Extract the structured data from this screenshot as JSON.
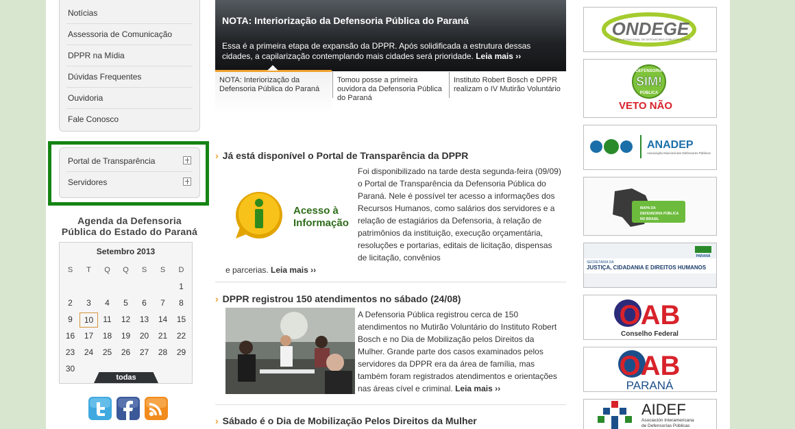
{
  "left_menu": {
    "items": [
      {
        "label": "Notícias"
      },
      {
        "label": "Assessoria de Comunicação"
      },
      {
        "label": "DPPR na Mídia"
      },
      {
        "label": "Dúvidas Frequentes"
      },
      {
        "label": "Ouvidoria"
      },
      {
        "label": "Fale Conosco"
      }
    ]
  },
  "transparency_menu": {
    "items": [
      {
        "label": "Portal de Transparência"
      },
      {
        "label": "Servidores"
      }
    ],
    "highlight_color": "#168414"
  },
  "agenda": {
    "title_line1": "Agenda da Defensoria",
    "title_line2": "Pública do Estado do Paraná",
    "month": "Setembro 2013",
    "weekdays": [
      "S",
      "T",
      "Q",
      "Q",
      "S",
      "S",
      "D"
    ],
    "weeks": [
      [
        "",
        "",
        "",
        "",
        "",
        "",
        "1"
      ],
      [
        "2",
        "3",
        "4",
        "5",
        "6",
        "7",
        "8"
      ],
      [
        "9",
        "10",
        "11",
        "12",
        "13",
        "14",
        "15"
      ],
      [
        "16",
        "17",
        "18",
        "19",
        "20",
        "21",
        "22"
      ],
      [
        "23",
        "24",
        "25",
        "26",
        "27",
        "28",
        "29"
      ],
      [
        "30",
        "",
        "",
        "",
        "",
        "",
        ""
      ]
    ],
    "today": "10",
    "all_label": "todas"
  },
  "social": {
    "icons": [
      "twitter-icon",
      "facebook-icon",
      "rss-icon"
    ]
  },
  "slider": {
    "title": "NOTA: Interiorização da Defensoria Pública do Paraná",
    "text": "Essa é a primeira etapa de expansão da DPPR. Após solidificada a estrutura dessas cidades, a capilarização contemplando mais cidades será prioridade.",
    "more": "Leia mais ››",
    "tabs": [
      {
        "label": "NOTA: Interiorização da Defensoria Pública do Paraná"
      },
      {
        "label": "Tomou posse a primeira ouvidora da Defensoria Pública do Paraná"
      },
      {
        "label": "Instituto Robert Bosch e DPPR realizam o IV Mutirão Voluntário"
      }
    ],
    "accent_color": "#f0a22e"
  },
  "news": [
    {
      "title": "Já está disponível o Portal de Transparência da DPPR",
      "body": "Foi disponibilizado na tarde desta segunda-feira (09/09) o Portal de Transparência da Defensoria Pública do Paraná. Nele é possível ter acesso a informações dos Recursos Humanos, como salários dos servidores e a relação de estagiários da Defensoria, à relação de patrimônios da instituição, execução orçamentária, resoluções e portarias, editais de licitação, dispensas de licitação, convênios e parcerias.",
      "more": "Leia mais ››",
      "image_text_line1": "Acesso à",
      "image_text_line2": "Informação"
    },
    {
      "title": "DPPR registrou 150 atendimentos no sábado (24/08)",
      "body": "A Defensoria Pública registrou cerca de 150 atendimentos no Mutirão Voluntário do Instituto Robert Bosch e no Dia de Mobilização pelos Direitos da Mulher. Grande parte dos casos examinados pelos servidores da DPPR era da área de família, mas também foram registrados atendimentos e orientações nas áreas cível e criminal.",
      "more": "Leia mais ››"
    },
    {
      "title": "Sábado é o Dia de Mobilização Pelos Direitos da Mulher"
    }
  ],
  "banners": {
    "ondege": {
      "text": "ONDEGE",
      "sub": "CONSELHO NACIONAL DE DEFENSORES PÚBLICOS GERAIS"
    },
    "veto": {
      "seal_top": "DEFENSORIA",
      "seal_mid": "SIM!",
      "seal_bottom": "PÚBLICA",
      "text": "VETO NÃO"
    },
    "anadep": {
      "text": "ANADEP",
      "sub": "Associação Nacional dos Defensores Públicos"
    },
    "mapa": {
      "line1": "MAPA DA",
      "line2": "DEFENSORIA PÚBLICA",
      "line3": "NO BRASIL"
    },
    "justica": {
      "line1": "SECRETARIA DA",
      "line2": "JUSTIÇA, CIDADANIA E DIREITOS HUMANOS",
      "state": "PARANÁ"
    },
    "oab_cf": {
      "text": "OAB",
      "sub": "Conselho Federal"
    },
    "oab_pr": {
      "text": "OAB",
      "sub": "PARANÁ"
    },
    "aidef": {
      "text": "AIDEF",
      "sub1": "Asociación Interamericana",
      "sub2": "de Defensorías Públicas"
    }
  }
}
